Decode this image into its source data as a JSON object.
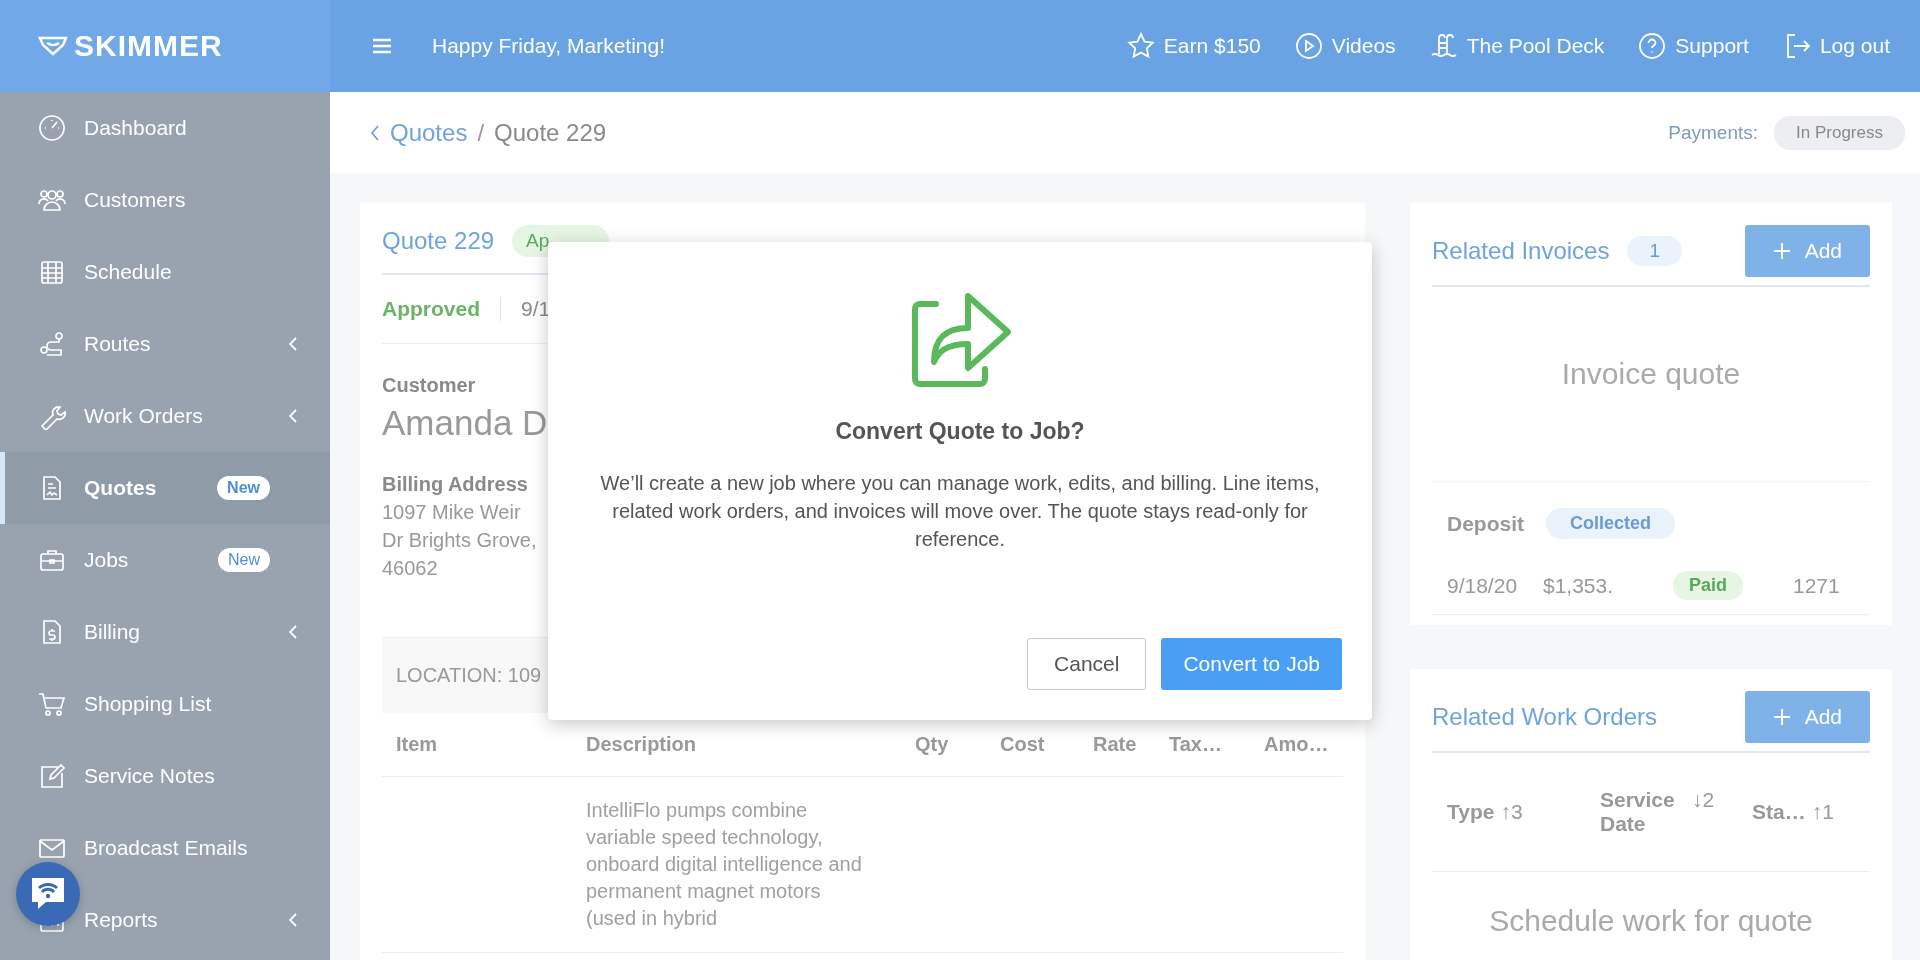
{
  "brand": {
    "name": "SKIMMER"
  },
  "topbar": {
    "greeting": "Happy Friday, Marketing!",
    "links": [
      {
        "kind": "star",
        "label": "Earn $150"
      },
      {
        "kind": "play",
        "label": "Videos"
      },
      {
        "kind": "pool",
        "label": "The Pool Deck"
      },
      {
        "kind": "help",
        "label": "Support"
      },
      {
        "kind": "logout",
        "label": "Log out"
      }
    ]
  },
  "sidebar": {
    "items": [
      {
        "kind": "gauge",
        "label": "Dashboard",
        "selected": false,
        "submenu": false
      },
      {
        "kind": "users",
        "label": "Customers",
        "selected": false,
        "submenu": false
      },
      {
        "kind": "calendar",
        "label": "Schedule",
        "selected": false,
        "submenu": false
      },
      {
        "kind": "route",
        "label": "Routes",
        "selected": false,
        "submenu": true
      },
      {
        "kind": "wrench",
        "label": "Work Orders",
        "selected": false,
        "submenu": true
      },
      {
        "kind": "doc",
        "label": "Quotes",
        "selected": true,
        "submenu": false,
        "badge": "New"
      },
      {
        "kind": "briefcase",
        "label": "Jobs",
        "selected": false,
        "submenu": false,
        "badge": "New"
      },
      {
        "kind": "bill",
        "label": "Billing",
        "selected": false,
        "submenu": true
      },
      {
        "kind": "cart",
        "label": "Shopping List",
        "selected": false,
        "submenu": false
      },
      {
        "kind": "edit",
        "label": "Service Notes",
        "selected": false,
        "submenu": false
      },
      {
        "kind": "mail",
        "label": "Broadcast Emails",
        "selected": false,
        "submenu": false
      },
      {
        "kind": "chart",
        "label": "Reports",
        "selected": false,
        "submenu": true
      }
    ]
  },
  "breadcrumb": {
    "parent": "Quotes",
    "separator": "/",
    "current": "Quote 229"
  },
  "payments": {
    "label": "Payments:",
    "status": "In Progress"
  },
  "quote": {
    "title": "Quote 229",
    "badge": "Ap",
    "status": "Approved",
    "date": "9/1",
    "customer_label": "Customer",
    "customer_name": "Amanda D",
    "billing_label": "Billing Address",
    "billing_lines": [
      "1097 Mike Weir",
      "Dr Brights Grove,",
      "46062"
    ],
    "location": "LOCATION: 109",
    "table": {
      "columns": [
        "Item",
        "Description",
        "Qty",
        "Cost",
        "Rate",
        "Tax…",
        "Amo…"
      ],
      "rows": [
        {
          "description": "IntelliFlo pumps combine variable speed technology, onboard digital intelligence and permanent magnet motors (used in hybrid"
        }
      ]
    }
  },
  "invoices": {
    "title": "Related Invoices",
    "count": "1",
    "add": "Add",
    "empty": "Invoice quote",
    "deposit_label": "Deposit",
    "deposit_status": "Collected",
    "rows": [
      {
        "date": "9/18/20",
        "amount": "$1,353.",
        "status": "Paid",
        "number": "1271"
      }
    ]
  },
  "work_orders": {
    "title": "Related Work Orders",
    "add": "Add",
    "columns": [
      {
        "label": "Type",
        "arrow": "↑",
        "order": "3"
      },
      {
        "label": "Service Date",
        "arrow": "↓",
        "order": "2"
      },
      {
        "label": "Sta…",
        "arrow": "↑",
        "order": "1"
      }
    ],
    "empty": "Schedule work for quote"
  },
  "dialog": {
    "title": "Convert Quote to Job?",
    "body": "We’ll create a new job where you can manage work, edits, and billing. Line items, related work orders, and invoices will move over. The quote stays read-only for reference.",
    "cancel": "Cancel",
    "confirm": "Convert to Job"
  }
}
